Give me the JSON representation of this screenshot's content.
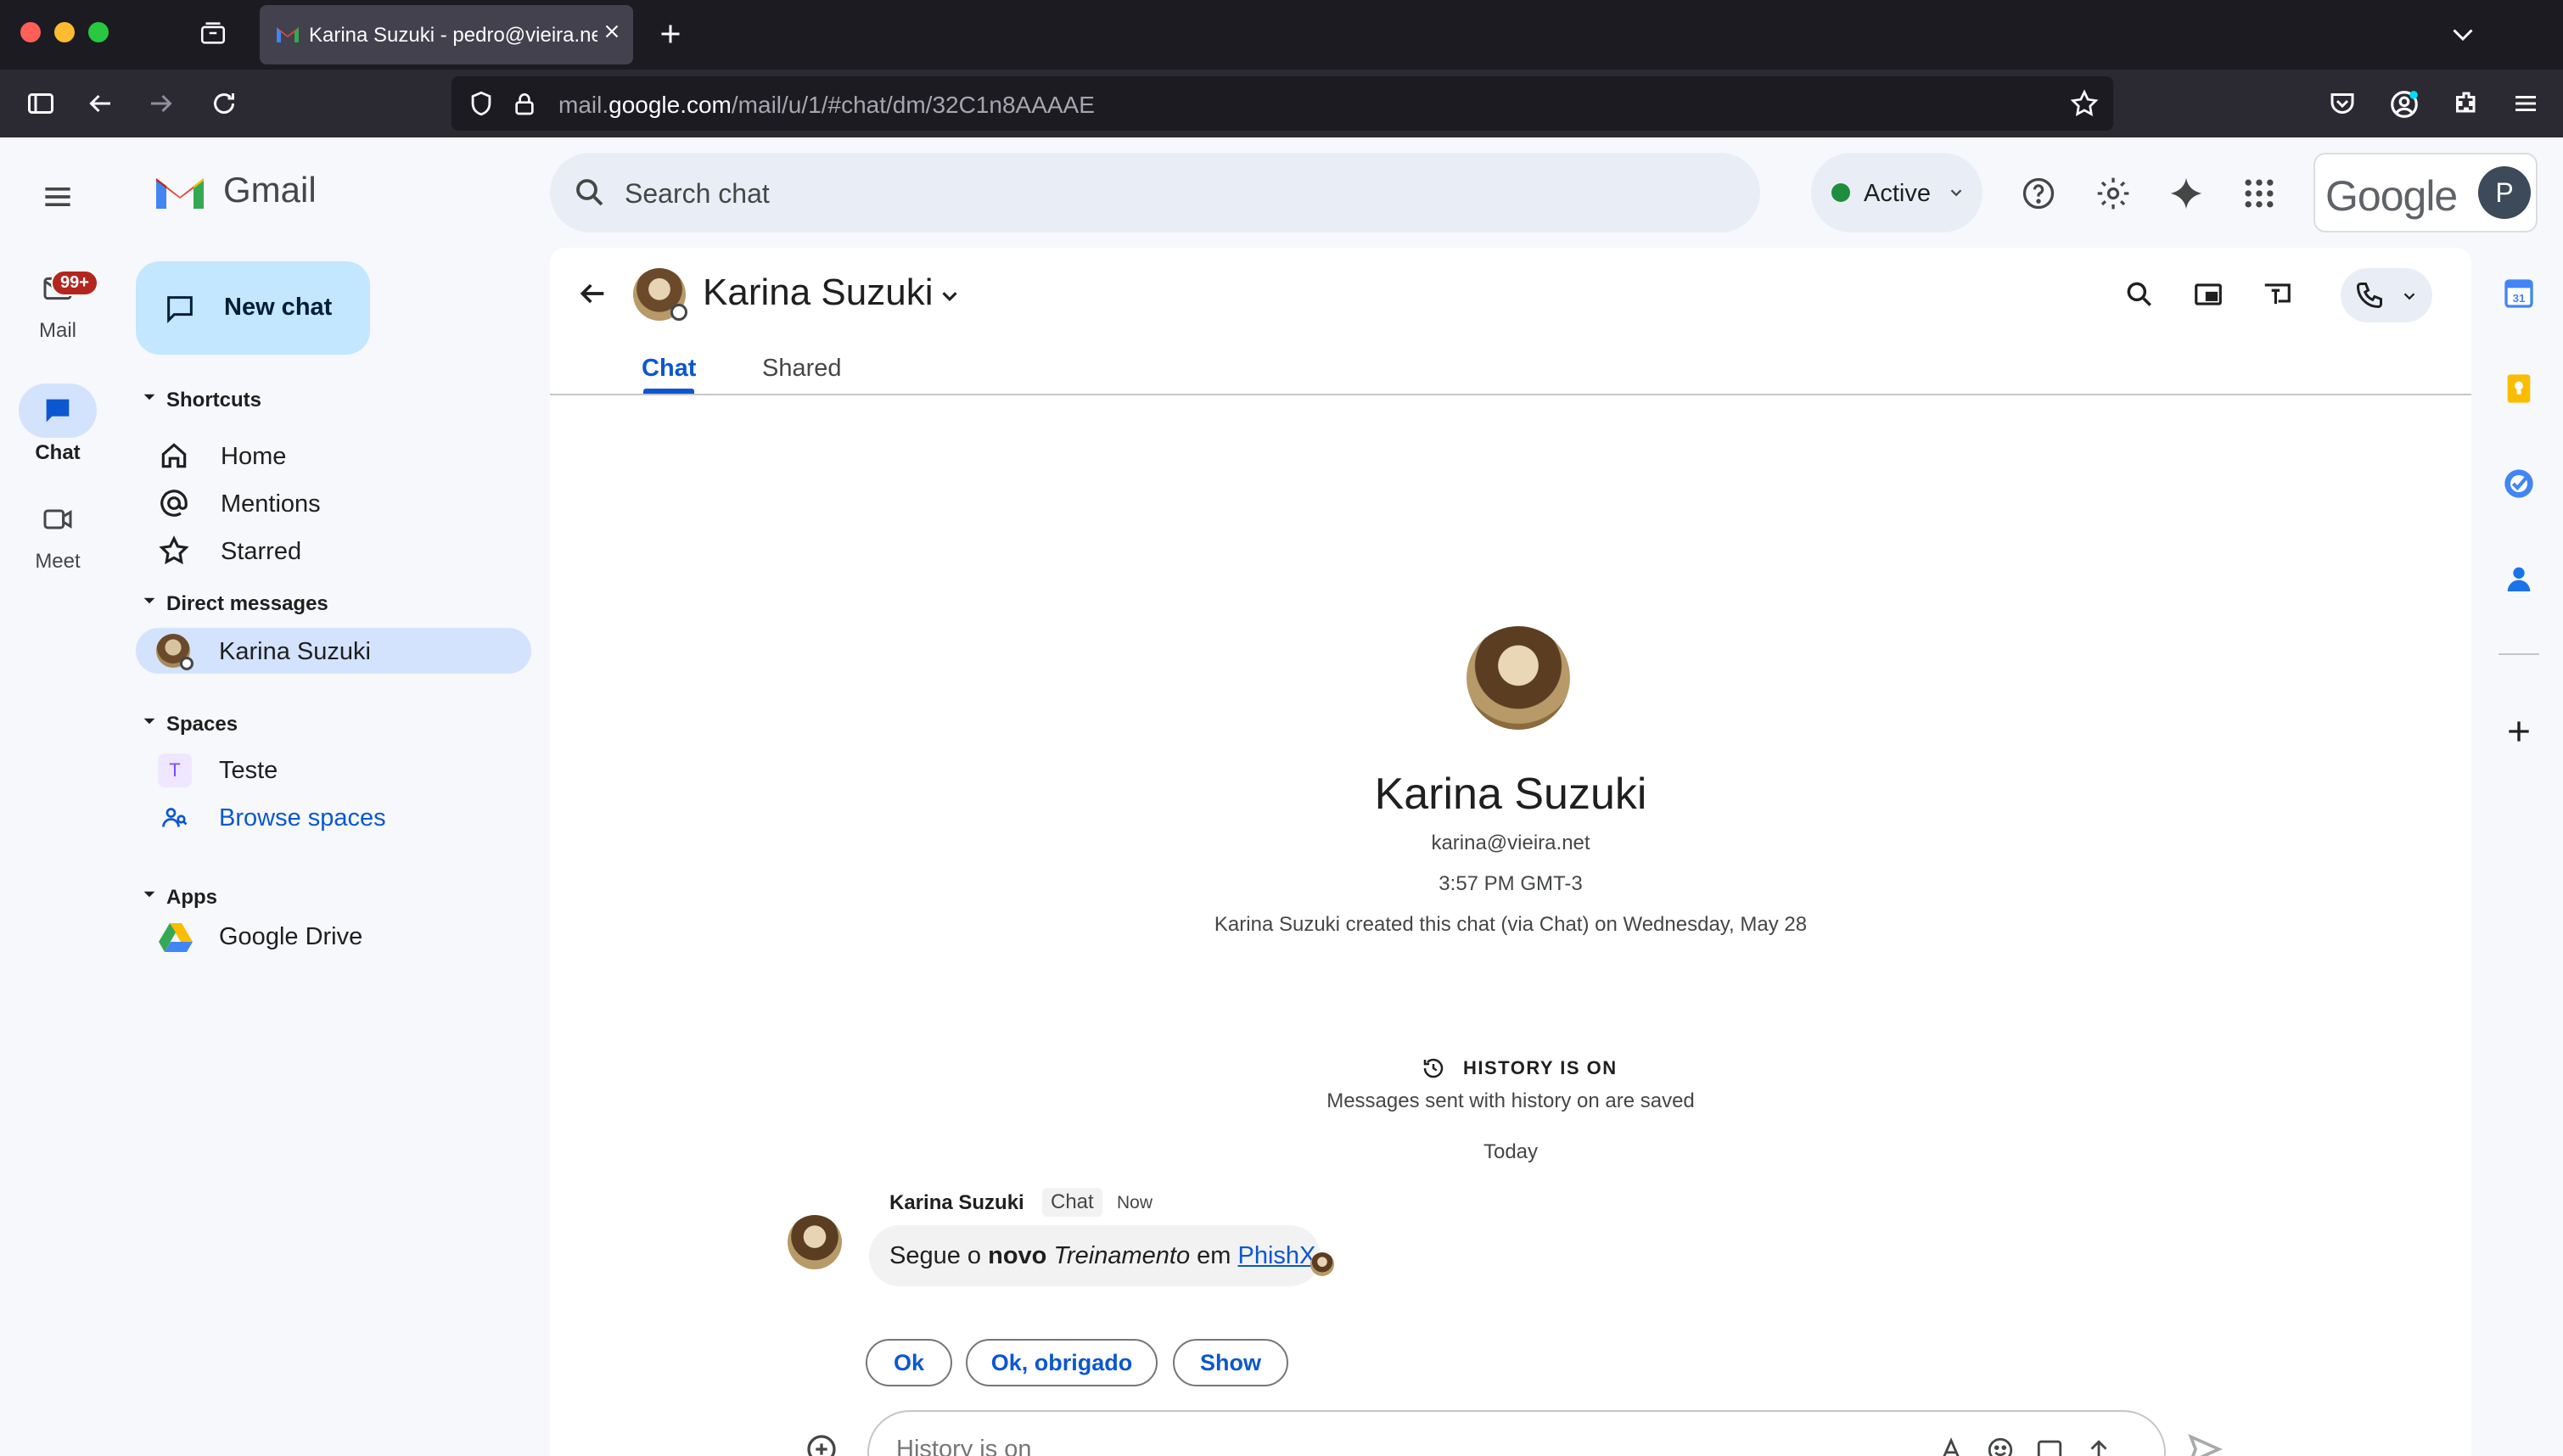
{
  "browser": {
    "tab_title": "Karina Suzuki - pedro@vieira.net",
    "url_prefix": "mail.",
    "url_domain": "google.com",
    "url_path": "/mail/u/1/#chat/dm/32C1n8AAAAE"
  },
  "rail": {
    "mail_label": "Mail",
    "mail_badge": "99+",
    "chat_label": "Chat",
    "meet_label": "Meet"
  },
  "app": {
    "name": "Gmail",
    "new_chat_label": "New chat"
  },
  "sidebar": {
    "shortcuts_title": "Shortcuts",
    "shortcuts": [
      {
        "label": "Home",
        "icon": "home-icon"
      },
      {
        "label": "Mentions",
        "icon": "at-icon"
      },
      {
        "label": "Starred",
        "icon": "star-icon"
      }
    ],
    "dm_title": "Direct messages",
    "dms": [
      {
        "label": "Karina Suzuki"
      }
    ],
    "spaces_title": "Spaces",
    "spaces": [
      {
        "label": "Teste",
        "initial": "T"
      },
      {
        "label": "Browse spaces"
      }
    ],
    "apps_title": "Apps",
    "apps": [
      {
        "label": "Google Drive"
      }
    ]
  },
  "topbar": {
    "search_placeholder": "Search chat",
    "status_label": "Active",
    "brand": "Google",
    "avatar_initial": "P"
  },
  "conversation": {
    "contact_name": "Karina Suzuki",
    "tabs": [
      {
        "label": "Chat",
        "active": true
      },
      {
        "label": "Shared",
        "active": false
      }
    ],
    "profile": {
      "name": "Karina Suzuki",
      "email": "karina@vieira.net",
      "local_time": "3:57 PM GMT-3",
      "created_note": "Karina Suzuki created this chat (via Chat) on Wednesday, May 28"
    },
    "history_title": "HISTORY IS ON",
    "history_note": "Messages sent with history on are saved",
    "date_divider": "Today",
    "message": {
      "sender": "Karina Suzuki",
      "source_tag": "Chat",
      "time": "Now",
      "text_part1": "Segue o ",
      "text_bold": "novo",
      "text_italic": "Treinamento",
      "text_part2": " em ",
      "link_text": "PhishX"
    },
    "quick_replies": [
      "Ok",
      "Ok, obrigado",
      "Show"
    ],
    "composer_placeholder": "History is on"
  },
  "colors": {
    "accent_blue": "#0b57d0",
    "active_green": "#1e8e3e",
    "badge_red": "#b3261e",
    "selected_bg": "#d3e3fd",
    "compose_bg": "#c2e7ff"
  }
}
